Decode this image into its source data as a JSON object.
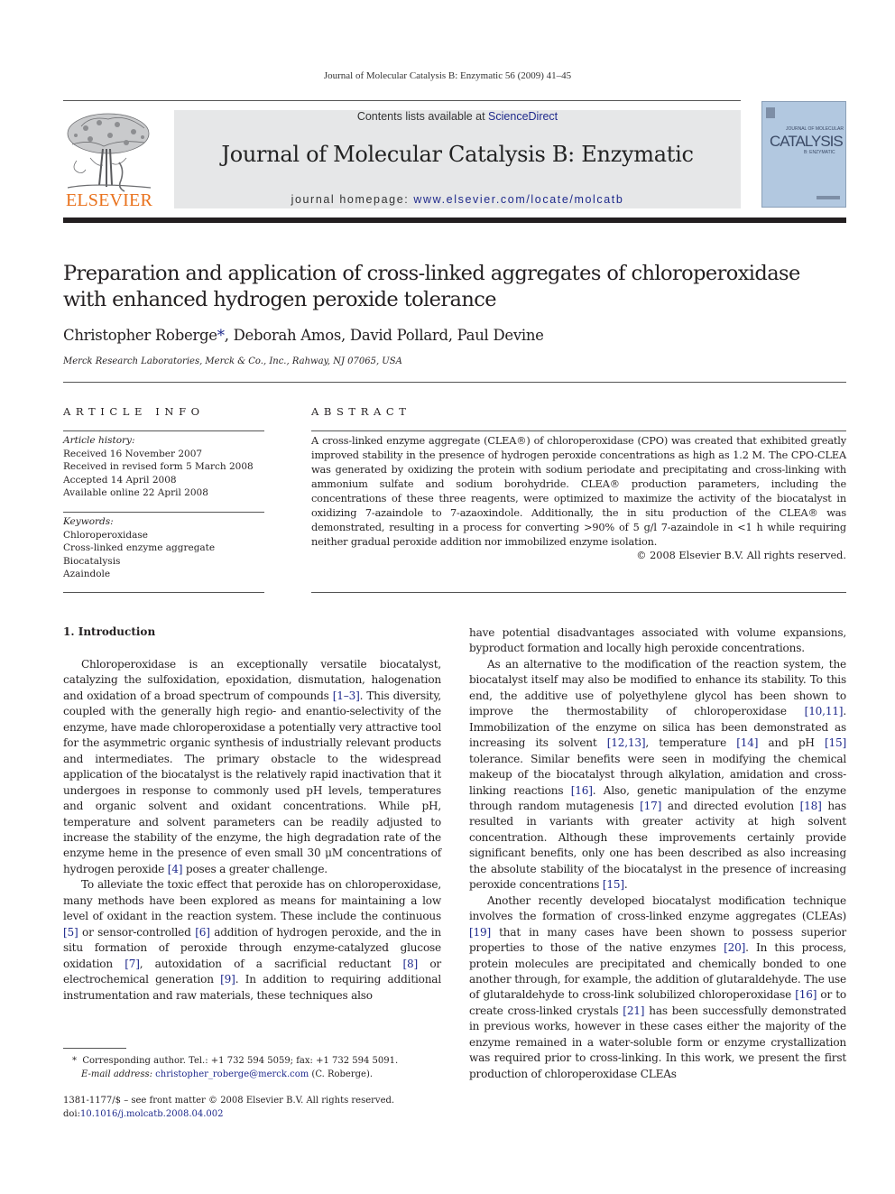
{
  "running_head": "Journal of Molecular Catalysis B: Enzymatic 56 (2009) 41–45",
  "banner": {
    "contents_prefix": "Contents lists available at ",
    "contents_link": "ScienceDirect",
    "journal_title": "Journal of Molecular Catalysis B: Enzymatic",
    "homepage_prefix": "journal homepage: ",
    "homepage_link": "www.elsevier.com/locate/molcatb"
  },
  "publisher_logo": {
    "name": "ELSEVIER",
    "color": "#e9711c"
  },
  "cover": {
    "top_line": "JOURNAL OF MOLECULAR",
    "title": "CATALYSIS",
    "subtitle": "B: ENZYMATIC",
    "color": "#b2c8e0"
  },
  "article": {
    "title": "Preparation and application of cross-linked aggregates of chloroperoxidase with enhanced hydrogen peroxide tolerance",
    "authors": [
      {
        "name": "Christopher Roberge",
        "marker": "*"
      },
      {
        "name": "Deborah Amos"
      },
      {
        "name": "David Pollard"
      },
      {
        "name": "Paul Devine"
      }
    ],
    "affiliation": "Merck Research Laboratories, Merck & Co., Inc., Rahway, NJ 07065, USA"
  },
  "article_info": {
    "heading": "ARTICLE INFO",
    "history_label": "Article history:",
    "history": [
      "Received 16 November 2007",
      "Received in revised form 5 March 2008",
      "Accepted 14 April 2008",
      "Available online 22 April 2008"
    ],
    "keywords_label": "Keywords:",
    "keywords": [
      "Chloroperoxidase",
      "Cross-linked enzyme aggregate",
      "Biocatalysis",
      "Azaindole"
    ]
  },
  "abstract": {
    "heading": "ABSTRACT",
    "text": "A cross-linked enzyme aggregate (CLEA®) of chloroperoxidase (CPO) was created that exhibited greatly improved stability in the presence of hydrogen peroxide concentrations as high as 1.2 M. The CPO-CLEA was generated by oxidizing the protein with sodium periodate and precipitating and cross-linking with ammonium sulfate and sodium borohydride. CLEA® production parameters, including the concentrations of these three reagents, were optimized to maximize the activity of the biocatalyst in oxidizing 7-azaindole to 7-azaoxindole. Additionally, the in situ production of the CLEA® was demonstrated, resulting in a process for converting >90% of 5 g/l 7-azaindole in <1 h while requiring neither gradual peroxide addition nor immobilized enzyme isolation.",
    "copyright": "© 2008 Elsevier B.V. All rights reserved."
  },
  "intro": {
    "heading": "1.  Introduction",
    "left_column": [
      [
        {
          "t": "Chloroperoxidase is an exceptionally versatile biocatalyst, catalyzing the sulfoxidation, epoxidation, dismutation, halogenation and oxidation of a broad spectrum of compounds "
        },
        {
          "r": "[1–3]"
        },
        {
          "t": ". This diversity, coupled with the generally high regio- and enantio-selectivity of the enzyme, have made chloroperoxidase a potentially very attractive tool for the asymmetric organic synthesis of industrially relevant products and intermediates. The primary obstacle to the widespread application of the biocatalyst is the relatively rapid inactivation that it undergoes in response to commonly used pH levels, temperatures and organic solvent and oxidant concentrations. While pH, temperature and solvent parameters can be readily adjusted to increase the stability of the enzyme, the high degradation rate of the enzyme heme in the presence of even small 30 μM concentrations of hydrogen peroxide "
        },
        {
          "r": "[4]"
        },
        {
          "t": " poses a greater challenge."
        }
      ],
      [
        {
          "t": "To alleviate the toxic effect that peroxide has on chloroperoxidase, many methods have been explored as means for maintaining a low level of oxidant in the reaction system. These include the continuous "
        },
        {
          "r": "[5]"
        },
        {
          "t": " or sensor-controlled "
        },
        {
          "r": "[6]"
        },
        {
          "t": " addition of hydrogen peroxide, and the in situ formation of peroxide through enzyme-catalyzed glucose oxidation "
        },
        {
          "r": "[7]"
        },
        {
          "t": ", autoxidation of a sacrificial reductant "
        },
        {
          "r": "[8]"
        },
        {
          "t": " or electrochemical generation "
        },
        {
          "r": "[9]"
        },
        {
          "t": ". In addition to requiring additional instrumentation and raw materials, these techniques also"
        }
      ]
    ],
    "right_column": [
      [
        {
          "t": "have potential disadvantages associated with volume expansions, byproduct formation and locally high peroxide concentrations."
        }
      ],
      [
        {
          "t": "As an alternative to the modification of the reaction system, the biocatalyst itself may also be modified to enhance its stability. To this end, the additive use of polyethylene glycol has been shown to improve the thermostability of chloroperoxidase "
        },
        {
          "r": "[10,11]"
        },
        {
          "t": ". Immobilization of the enzyme on silica has been demonstrated as increasing its solvent "
        },
        {
          "r": "[12,13]"
        },
        {
          "t": ", temperature "
        },
        {
          "r": "[14]"
        },
        {
          "t": " and pH "
        },
        {
          "r": "[15]"
        },
        {
          "t": " tolerance. Similar benefits were seen in modifying the chemical makeup of the biocatalyst through alkylation, amidation and cross-linking reactions "
        },
        {
          "r": "[16]"
        },
        {
          "t": ". Also, genetic manipulation of the enzyme through random mutagenesis "
        },
        {
          "r": "[17]"
        },
        {
          "t": " and directed evolution "
        },
        {
          "r": "[18]"
        },
        {
          "t": " has resulted in variants with greater activity at high solvent concentration. Although these improvements certainly provide significant benefits, only one has been described as also increasing the absolute stability of the biocatalyst in the presence of increasing peroxide concentrations "
        },
        {
          "r": "[15]"
        },
        {
          "t": "."
        }
      ],
      [
        {
          "t": "Another recently developed biocatalyst modification technique involves the formation of cross-linked enzyme aggregates (CLEAs) "
        },
        {
          "r": "[19]"
        },
        {
          "t": " that in many cases have been shown to possess superior properties to those of the native enzymes "
        },
        {
          "r": "[20]"
        },
        {
          "t": ". In this process, protein molecules are precipitated and chemically bonded to one another through, for example, the addition of glutaraldehyde. The use of glutaraldehyde to cross-link solubilized chloroperoxidase "
        },
        {
          "r": "[16]"
        },
        {
          "t": " or to create cross-linked crystals "
        },
        {
          "r": "[21]"
        },
        {
          "t": " has been successfully demonstrated in previous works, however in these cases either the majority of the enzyme remained in a water-soluble form or enzyme crystallization was required prior to cross-linking. In this work, we present the first production of chloroperoxidase CLEAs"
        }
      ]
    ]
  },
  "footnote": {
    "marker": "*",
    "corresponding": "Corresponding author. Tel.: +1 732 594 5059; fax: +1 732 594 5091.",
    "email_label": "E-mail address:",
    "email": "christopher_roberge@merck.com",
    "email_suffix": " (C. Roberge)."
  },
  "front_matter": {
    "issn_line": "1381-1177/$ – see front matter © 2008 Elsevier B.V. All rights reserved.",
    "doi_prefix": "doi:",
    "doi": "10.1016/j.molcatb.2008.04.002"
  },
  "colors": {
    "link": "#1f2a8c",
    "banner_bg": "#e6e7e8",
    "elsevier_orange": "#e9711c"
  }
}
